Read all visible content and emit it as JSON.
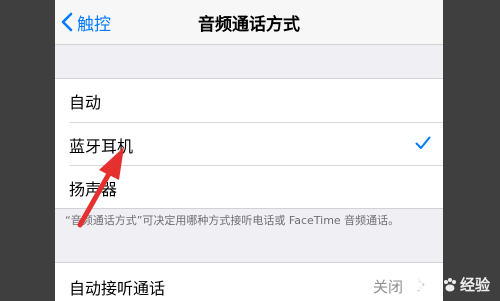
{
  "nav": {
    "back_label": "触控",
    "title": "音频通话方式"
  },
  "options": [
    {
      "label": "自动",
      "checked": false
    },
    {
      "label": "蓝牙耳机",
      "checked": true
    },
    {
      "label": "扬声器",
      "checked": false
    }
  ],
  "footer_text": "“音频通话方式”可决定用哪种方式接听电话或 FaceTime 音频通话。",
  "auto_answer": {
    "label": "自动接听通话",
    "value": "关闭"
  },
  "watermark": {
    "text_left": "Bai",
    "text_right": "经验"
  },
  "colors": {
    "accent": "#007aff",
    "annotation_arrow": "#e53030"
  }
}
